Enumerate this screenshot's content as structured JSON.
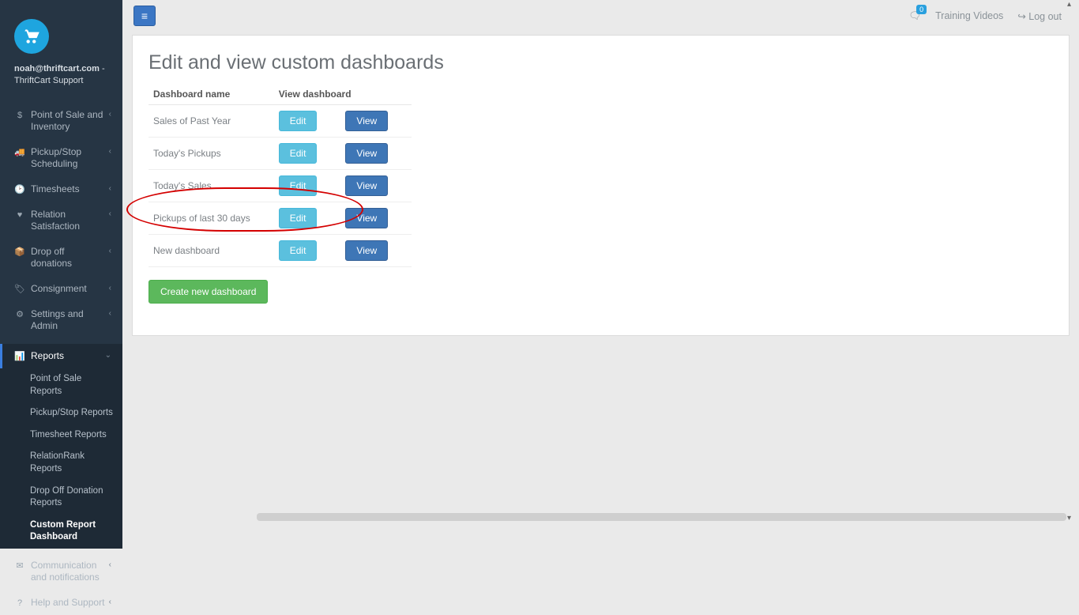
{
  "sidebar": {
    "user_line1": "noah@thriftcart.com",
    "user_sep": " - ",
    "user_line2": "ThriftCart Support",
    "items": [
      {
        "icon": "$",
        "label": "Point of Sale and Inventory",
        "chev": "‹"
      },
      {
        "icon": "🚚",
        "label": "Pickup/Stop Scheduling",
        "chev": "‹"
      },
      {
        "icon": "🕑",
        "label": "Timesheets",
        "chev": "‹"
      },
      {
        "icon": "♥",
        "label": "Relation Satisfaction",
        "chev": "‹"
      },
      {
        "icon": "📦",
        "label": "Drop off donations",
        "chev": "‹"
      },
      {
        "icon": "🏷",
        "label": "Consignment",
        "chev": "‹"
      },
      {
        "icon": "⚙",
        "label": "Settings and Admin",
        "chev": "‹"
      }
    ],
    "reports": {
      "icon": "📊",
      "label": "Reports",
      "chev": "⌄",
      "sub": [
        {
          "label": "Point of Sale Reports"
        },
        {
          "label": "Pickup/Stop Reports"
        },
        {
          "label": "Timesheet Reports"
        },
        {
          "label": "RelationRank Reports"
        },
        {
          "label": "Drop Off Donation Reports"
        },
        {
          "label": "Custom Report Dashboard",
          "active": true
        }
      ]
    },
    "tail": [
      {
        "icon": "✉",
        "label": "Communication and notifications",
        "chev": "‹"
      },
      {
        "icon": "?",
        "label": "Help and Support",
        "chev": "‹"
      }
    ]
  },
  "topbar": {
    "notif_count": "0",
    "training_label": "Training Videos",
    "logout_label": "Log out"
  },
  "page": {
    "title": "Edit and view custom dashboards",
    "col_name": "Dashboard name",
    "col_view": "View dashboard",
    "rows": [
      {
        "name": "Sales of Past Year"
      },
      {
        "name": "Today's Pickups"
      },
      {
        "name": "Today's Sales"
      },
      {
        "name": "Pickups of last 30 days"
      },
      {
        "name": "New dashboard"
      }
    ],
    "edit_label": "Edit",
    "view_label": "View",
    "create_label": "Create new dashboard"
  }
}
